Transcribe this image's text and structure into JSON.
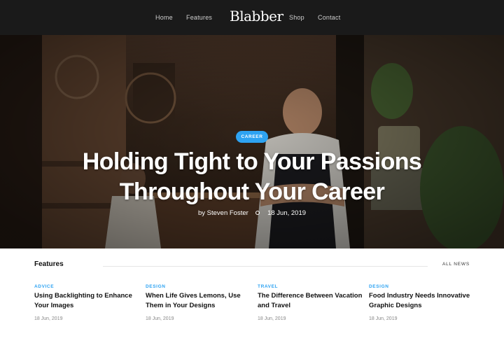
{
  "header": {
    "nav_left": [
      "Home",
      "Features"
    ],
    "brand": "Blabber",
    "nav_right": [
      "Shop",
      "Contact"
    ]
  },
  "hero": {
    "category": "CAREER",
    "title_line1": "Holding Tight to Your Passions",
    "title_line2": "Throughout Your Career",
    "author": "by Steven Foster",
    "date": "18 Jun, 2019"
  },
  "features": {
    "title": "Features",
    "all_news": "ALL NEWS",
    "cards": [
      {
        "category": "ADVICE",
        "title": "Using Backlighting to Enhance Your Images",
        "date": "18 Jun, 2019"
      },
      {
        "category": "DESIGN",
        "title": "When Life Gives Lemons, Use Them in Your Designs",
        "date": "18 Jun, 2019"
      },
      {
        "category": "TRAVEL",
        "title": "The Difference Between Vacation and Travel",
        "date": "18 Jun, 2019"
      },
      {
        "category": "DESIGN",
        "title": "Food Industry Needs Innovative Graphic Designs",
        "date": "18 Jun, 2019"
      }
    ]
  },
  "colors": {
    "accent": "#2ea3f2",
    "header_bg": "#1a1a1a"
  }
}
